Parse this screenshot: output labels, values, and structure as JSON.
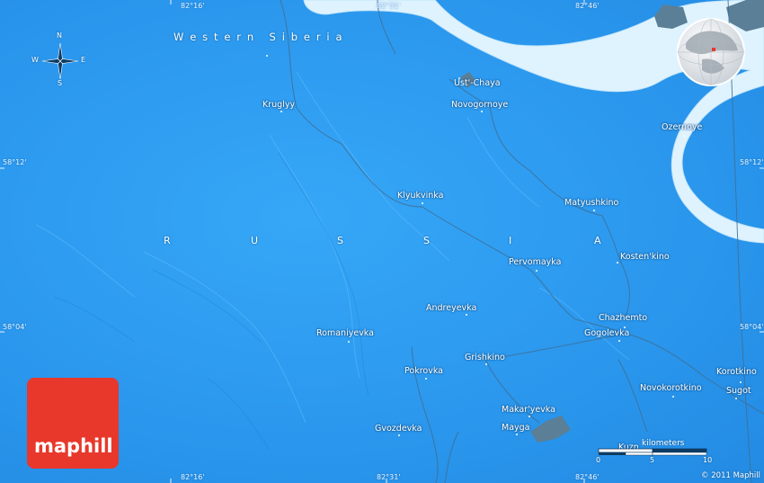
{
  "map": {
    "region_label": "W e s t e r n   S i b e r i a",
    "country_label": [
      "R",
      "U",
      "S",
      "S",
      "I",
      "A"
    ],
    "colors": {
      "background": "#2e9bf0",
      "river": "#dff3ff",
      "lake": "#5b7f96",
      "logo": "#e8382b"
    }
  },
  "coords": {
    "lon_top": [
      "82°16'",
      "82°31'",
      "82°46'"
    ],
    "lon_bottom": [
      "82°16'",
      "82°31'",
      "82°46'"
    ],
    "lat_left": [
      "58°12'",
      "58°04'"
    ],
    "lat_right": [
      "58°12'",
      "58°04'"
    ]
  },
  "compass": {
    "n": "N",
    "s": "S",
    "e": "E",
    "w": "W"
  },
  "places": {
    "ust_chaya": "Ust'-Chaya",
    "novogornoye": "Novogornoye",
    "kruglyy": "Kruglyy",
    "ozernoye": "Ozernoye",
    "klyukvinka": "Klyukvinka",
    "matyushkino": "Matyushkino",
    "pervomayka": "Pervomayka",
    "kostenkino": "Kosten'kino",
    "andreyevka": "Andreyevka",
    "chazhemto": "Chazhemto",
    "romaniyevka": "Romaniyevka",
    "gogolevka": "Gogolevka",
    "grishkino": "Grishkino",
    "pokrovka": "Pokrovka",
    "korotkino": "Korotkino",
    "novokorotkino": "Novokorotkino",
    "sugot": "Sugot",
    "makaryevka": "Makar'yevka",
    "mayga": "Mayga",
    "gvozdevka": "Gvozdevka",
    "kuznetsovo": "Kuzn"
  },
  "scale": {
    "label": "kilometers",
    "ticks": [
      "0",
      "5",
      "10"
    ]
  },
  "brand": {
    "logo_text": "maphill",
    "copyright": "© 2011 Maphill"
  }
}
